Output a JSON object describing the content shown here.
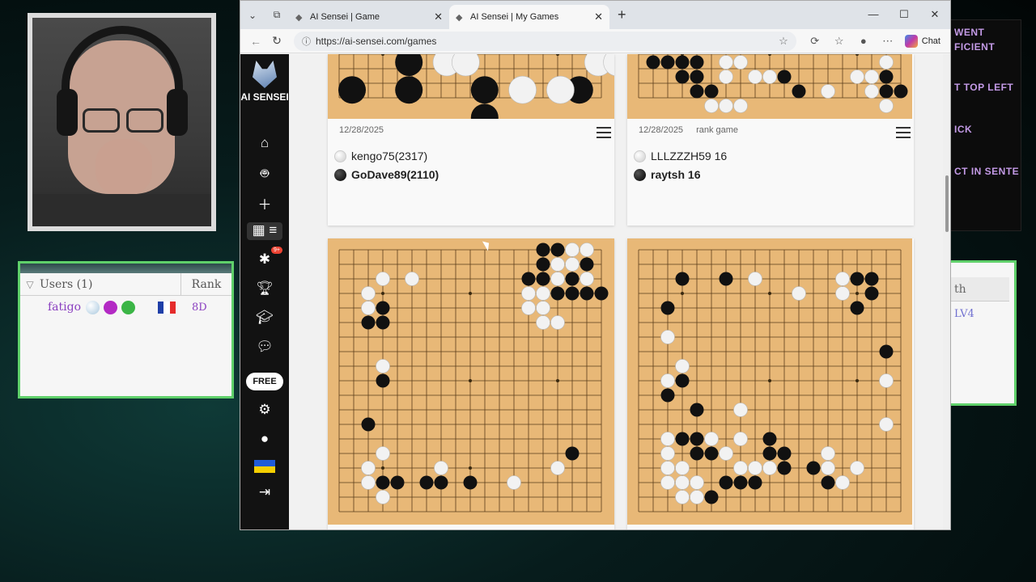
{
  "browser": {
    "tabs": [
      {
        "label": "AI Sensei | Game",
        "active": false
      },
      {
        "label": "AI Sensei | My Games",
        "active": true
      }
    ],
    "url": "https://ai-sensei.com/games",
    "chat_label": "Chat"
  },
  "sidebar": {
    "brand": "AI SENSEI",
    "badge": "9+",
    "free_label": "FREE"
  },
  "games": [
    {
      "date": "12/28/2025",
      "tag": "",
      "white": "kengo75(2317)",
      "black": "GoDave89(2110)"
    },
    {
      "date": "12/28/2025",
      "tag": "rank game",
      "white": "LLLZZZH59 16",
      "black": "raytsh 16"
    }
  ],
  "users_panel": {
    "title": "Users (1)",
    "rank_header": "Rank",
    "users": [
      {
        "name": "fatigo",
        "rank": "8D"
      }
    ]
  },
  "overlay": {
    "lines": [
      "WENT",
      "FICIENT",
      "T TOP LEFT",
      "ICK",
      "CT IN SENTE"
    ]
  },
  "right_panel": {
    "header": "th",
    "value": "LV4"
  },
  "colors": {
    "board": "#e8b877",
    "sidebar": "#121212",
    "panel_border": "#5fd06a",
    "user_name": "#8a3fc0"
  },
  "boards": {
    "top_left": {
      "black": [
        [
          3,
          0
        ],
        [
          0,
          1
        ],
        [
          3,
          1
        ],
        [
          7,
          1
        ],
        [
          7,
          2
        ],
        [
          12,
          1
        ],
        [
          15,
          1
        ]
      ],
      "white": [
        [
          5,
          0
        ],
        [
          6,
          0
        ],
        [
          9,
          1
        ],
        [
          11,
          1
        ],
        [
          13,
          0
        ],
        [
          14,
          0
        ]
      ]
    },
    "top_right": {
      "black": [
        [
          1,
          0
        ],
        [
          2,
          0
        ],
        [
          3,
          0
        ],
        [
          4,
          0
        ],
        [
          3,
          1
        ],
        [
          4,
          1
        ],
        [
          4,
          2
        ],
        [
          5,
          2
        ],
        [
          10,
          1
        ],
        [
          11,
          2
        ],
        [
          17,
          1
        ],
        [
          17,
          2
        ],
        [
          18,
          2
        ]
      ],
      "white": [
        [
          6,
          0
        ],
        [
          7,
          0
        ],
        [
          8,
          1
        ],
        [
          9,
          1
        ],
        [
          6,
          1
        ],
        [
          5,
          3
        ],
        [
          6,
          3
        ],
        [
          7,
          3
        ],
        [
          13,
          2
        ],
        [
          15,
          1
        ],
        [
          16,
          2
        ],
        [
          17,
          3
        ],
        [
          16,
          1
        ],
        [
          17,
          0
        ]
      ]
    },
    "bottom_left": {
      "black": [
        [
          2,
          4
        ],
        [
          3,
          4
        ],
        [
          2,
          5
        ],
        [
          3,
          5
        ],
        [
          3,
          9
        ],
        [
          2,
          12
        ],
        [
          13,
          2
        ],
        [
          14,
          2
        ],
        [
          15,
          2
        ],
        [
          14,
          1
        ],
        [
          14,
          0
        ],
        [
          15,
          0
        ],
        [
          17,
          1
        ],
        [
          16,
          2
        ],
        [
          17,
          3
        ],
        [
          18,
          3
        ],
        [
          15,
          3
        ],
        [
          16,
          3
        ],
        [
          17,
          2
        ],
        [
          14,
          4
        ],
        [
          3,
          16
        ],
        [
          4,
          16
        ],
        [
          6,
          16
        ],
        [
          7,
          16
        ],
        [
          9,
          16
        ],
        [
          16,
          14
        ],
        [
          2,
          15
        ]
      ],
      "white": [
        [
          3,
          2
        ],
        [
          5,
          2
        ],
        [
          2,
          3
        ],
        [
          2,
          4
        ],
        [
          3,
          8
        ],
        [
          15,
          1
        ],
        [
          15,
          2
        ],
        [
          16,
          1
        ],
        [
          16,
          0
        ],
        [
          17,
          0
        ],
        [
          17,
          2
        ],
        [
          14,
          3
        ],
        [
          14,
          4
        ],
        [
          13,
          3
        ],
        [
          13,
          4
        ],
        [
          14,
          5
        ],
        [
          15,
          5
        ],
        [
          3,
          14
        ],
        [
          7,
          15
        ],
        [
          12,
          16
        ],
        [
          15,
          15
        ],
        [
          2,
          15
        ],
        [
          2,
          16
        ],
        [
          3,
          17
        ]
      ]
    },
    "bottom_right": {
      "black": [
        [
          3,
          2
        ],
        [
          6,
          2
        ],
        [
          15,
          2
        ],
        [
          16,
          3
        ],
        [
          16,
          2
        ],
        [
          15,
          4
        ],
        [
          2,
          4
        ],
        [
          3,
          8
        ],
        [
          3,
          9
        ],
        [
          17,
          7
        ],
        [
          2,
          10
        ],
        [
          4,
          11
        ],
        [
          3,
          13
        ],
        [
          4,
          13
        ],
        [
          4,
          14
        ],
        [
          5,
          14
        ],
        [
          9,
          13
        ],
        [
          10,
          15
        ],
        [
          6,
          16
        ],
        [
          7,
          16
        ],
        [
          8,
          16
        ],
        [
          5,
          17
        ],
        [
          12,
          15
        ],
        [
          13,
          15
        ],
        [
          13,
          16
        ],
        [
          14,
          16
        ],
        [
          9,
          14
        ],
        [
          10,
          14
        ]
      ],
      "white": [
        [
          8,
          2
        ],
        [
          11,
          3
        ],
        [
          14,
          2
        ],
        [
          14,
          3
        ],
        [
          2,
          6
        ],
        [
          3,
          8
        ],
        [
          2,
          9
        ],
        [
          17,
          9
        ],
        [
          7,
          11
        ],
        [
          17,
          12
        ],
        [
          7,
          13
        ],
        [
          2,
          13
        ],
        [
          2,
          14
        ],
        [
          2,
          15
        ],
        [
          3,
          15
        ],
        [
          3,
          16
        ],
        [
          4,
          16
        ],
        [
          5,
          13
        ],
        [
          6,
          14
        ],
        [
          7,
          15
        ],
        [
          8,
          15
        ],
        [
          9,
          15
        ],
        [
          13,
          14
        ],
        [
          13,
          15
        ],
        [
          14,
          16
        ],
        [
          15,
          15
        ],
        [
          3,
          17
        ],
        [
          4,
          17
        ],
        [
          2,
          16
        ]
      ]
    }
  }
}
